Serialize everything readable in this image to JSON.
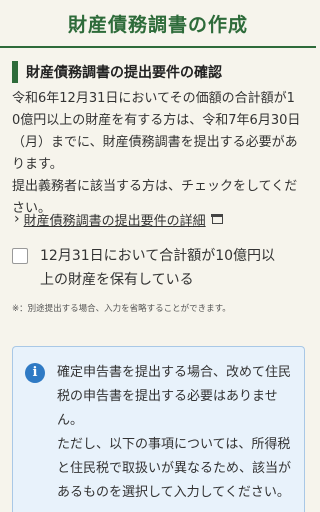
{
  "header": {
    "title": "財産債務調書の作成"
  },
  "section": {
    "title": "財産債務調書の提出要件の確認",
    "description_lines": [
      "令和6年12月31日においてその価額の合計額が1",
      "0億円以上の財産を有する方は、令和7年6月30日",
      "（月）までに、財産債務調書を提出する必要があ",
      "ります。",
      "提出義務者に該当する方は、チェックをしてくだ",
      "さい。"
    ],
    "link_label": "財産債務調書の提出要件の詳細"
  },
  "checkbox": {
    "checked": false,
    "label_lines": [
      "12月31日において合計額が10億円以",
      "上の財産を保有している"
    ]
  },
  "note": "※：別途提出する場合、入力を省略することができます。",
  "info": {
    "icon": "info-icon",
    "lines": [
      "確定申告書を提出する場合、改めて住民",
      "税の申告書を提出する必要はありませ",
      "ん。",
      "ただし、以下の事項については、所得税",
      "と住民税で取扱いが異なるため、該当が",
      "あるものを選択して入力してください。"
    ]
  },
  "colors": {
    "brand": "#2e6b3a",
    "info_bg": "#e8f2fb",
    "info_icon": "#2f7ac4"
  }
}
